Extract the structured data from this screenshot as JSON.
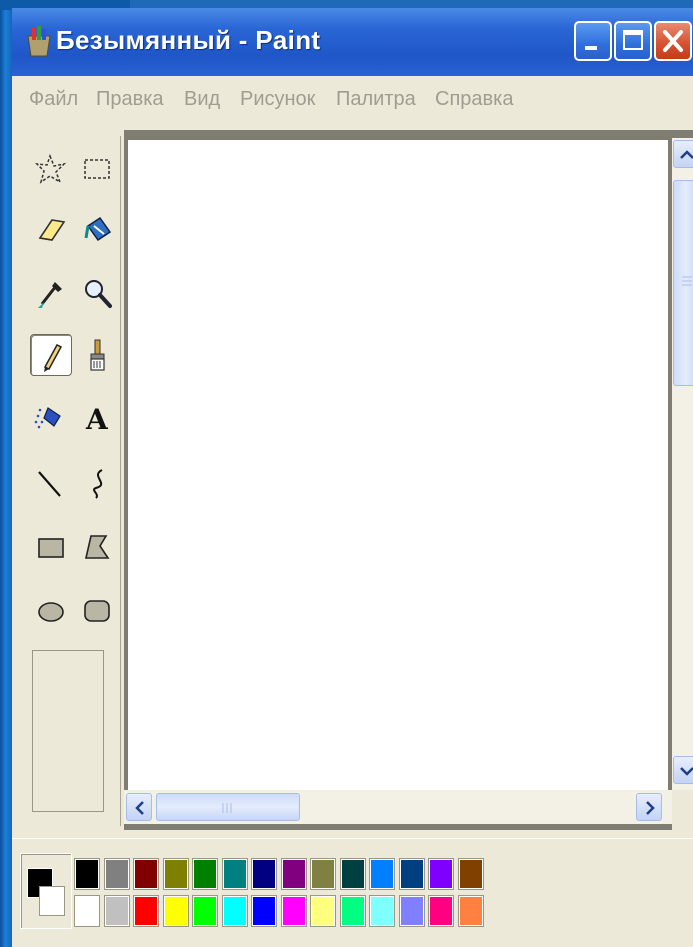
{
  "window": {
    "title": "Безымянный - Paint",
    "controls": {
      "minimize": "minimize-icon",
      "maximize": "maximize-icon",
      "close": "close-icon"
    }
  },
  "menu": {
    "items": [
      {
        "label": "Файл"
      },
      {
        "label": "Правка"
      },
      {
        "label": "Вид"
      },
      {
        "label": "Рисунок"
      },
      {
        "label": "Палитра"
      },
      {
        "label": "Справка"
      }
    ]
  },
  "tools": [
    {
      "name": "free-form-select",
      "icon": "free-form-select-icon"
    },
    {
      "name": "rect-select",
      "icon": "rect-select-icon"
    },
    {
      "name": "eraser",
      "icon": "eraser-icon"
    },
    {
      "name": "fill",
      "icon": "fill-bucket-icon"
    },
    {
      "name": "pick-color",
      "icon": "eyedropper-icon"
    },
    {
      "name": "magnifier",
      "icon": "magnifier-icon"
    },
    {
      "name": "pencil",
      "icon": "pencil-icon",
      "active": true
    },
    {
      "name": "brush",
      "icon": "brush-icon"
    },
    {
      "name": "airbrush",
      "icon": "airbrush-icon"
    },
    {
      "name": "text",
      "icon": "text-icon",
      "glyph": "A"
    },
    {
      "name": "line",
      "icon": "line-icon"
    },
    {
      "name": "curve",
      "icon": "curve-icon"
    },
    {
      "name": "rectangle",
      "icon": "rectangle-icon"
    },
    {
      "name": "polygon",
      "icon": "polygon-icon"
    },
    {
      "name": "ellipse",
      "icon": "ellipse-icon"
    },
    {
      "name": "rounded-rectangle",
      "icon": "rounded-rectangle-icon"
    }
  ],
  "colors": {
    "foreground": "#000000",
    "background": "#ffffff",
    "palette_row1": [
      "#000000",
      "#808080",
      "#800000",
      "#808000",
      "#008000",
      "#008080",
      "#000080",
      "#800080",
      "#808040",
      "#004040",
      "#0080ff",
      "#004080",
      "#8000ff",
      "#804000"
    ],
    "palette_row2": [
      "#ffffff",
      "#c0c0c0",
      "#ff0000",
      "#ffff00",
      "#00ff00",
      "#00ffff",
      "#0000ff",
      "#ff00ff",
      "#ffff80",
      "#00ff80",
      "#80ffff",
      "#8080ff",
      "#ff0080",
      "#ff8040"
    ]
  }
}
